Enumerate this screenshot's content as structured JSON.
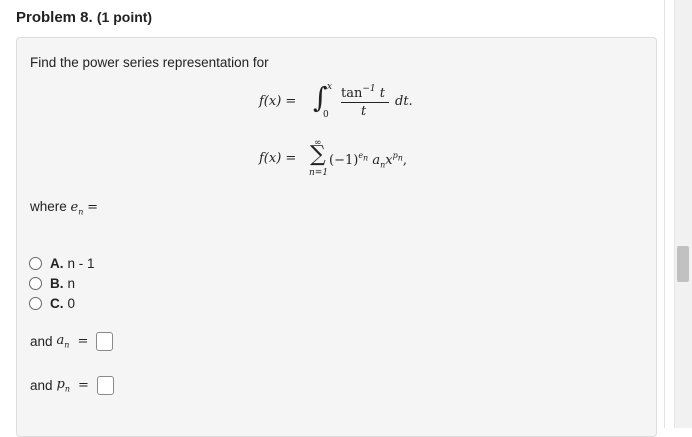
{
  "problem": {
    "title": "Problem 8.",
    "points": "(1 point)"
  },
  "question": {
    "prompt": "Find the power series representation for",
    "eq1": {
      "lhs": "f(x) =",
      "upper": "x",
      "lower": "0",
      "numerator": "tan",
      "numerator_sup": "−1",
      "numerator_var": "t",
      "denominator": "t",
      "tail": "dt."
    },
    "eq2": {
      "lhs": "f(x) =",
      "sum_top": "∞",
      "sum_sign": "∑",
      "sum_bottom": "n=1",
      "body_pre": "(−1)",
      "body_exp": "e",
      "body_exp_sub": "n",
      "body_coef": "a",
      "body_coef_sub": "n",
      "body_var": "x",
      "body_var_exp": "p",
      "body_var_exp_sub": "n",
      "body_tail": ","
    },
    "where_label": "where",
    "where_var": "e",
    "where_sub": "n",
    "where_eq": "="
  },
  "options": [
    {
      "letter": "A.",
      "text": "n - 1"
    },
    {
      "letter": "B.",
      "text": "n"
    },
    {
      "letter": "C.",
      "text": "0"
    }
  ],
  "answers": [
    {
      "label": "and",
      "var": "a",
      "sub": "n",
      "eq": "="
    },
    {
      "label": "and",
      "var": "p",
      "sub": "n",
      "eq": "="
    }
  ]
}
